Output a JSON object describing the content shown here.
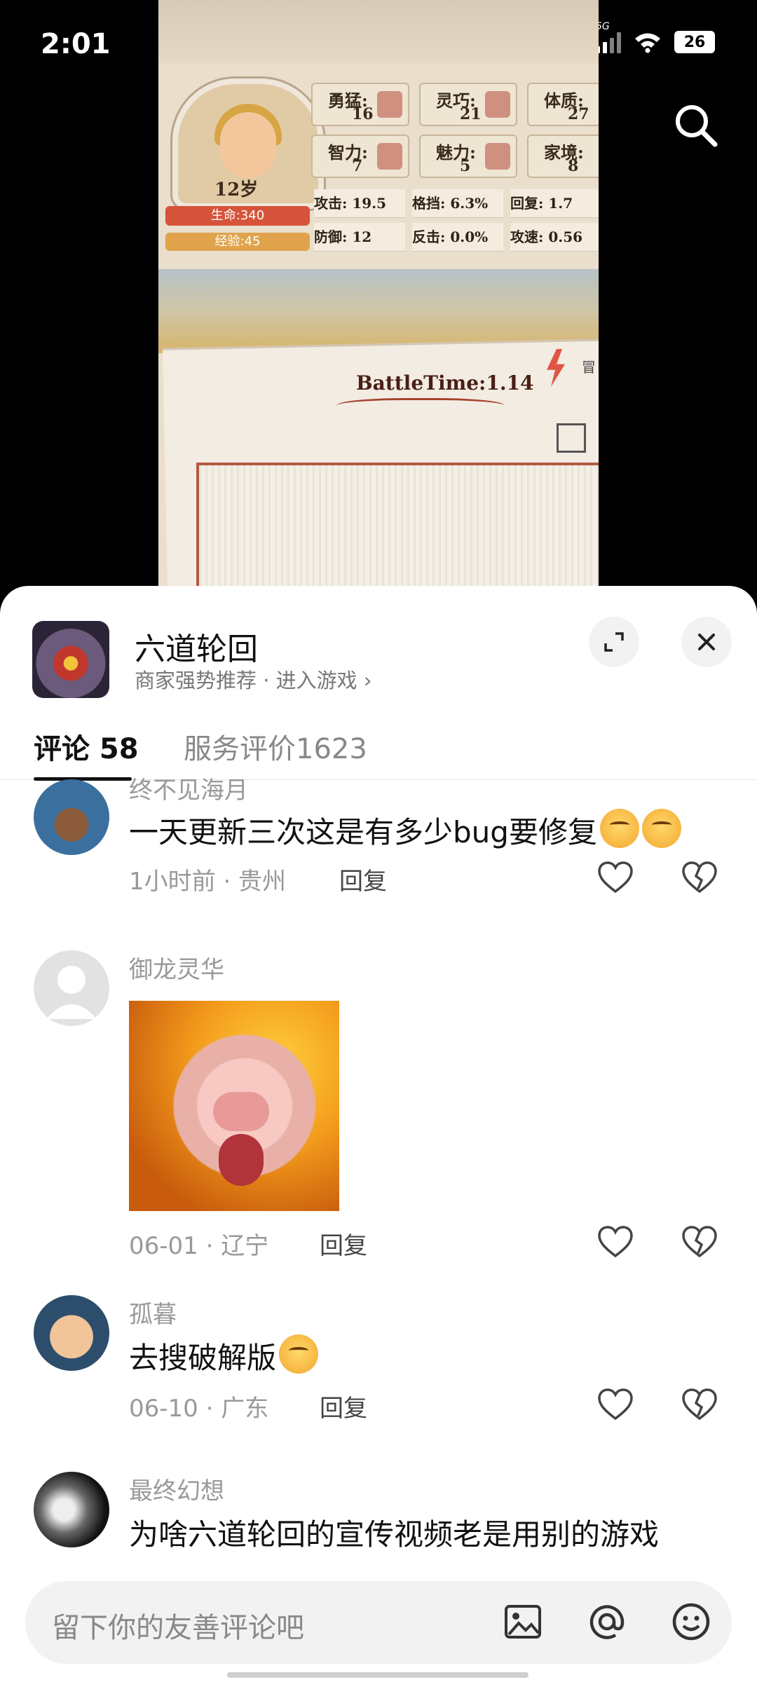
{
  "status_bar": {
    "time": "2:01",
    "signal_label_1": "5G",
    "signal_label_2": "5G",
    "battery": "26"
  },
  "game_video": {
    "age": "12岁",
    "hp": "生命:340",
    "xp": "经验:45",
    "stats": [
      {
        "name": "勇猛:",
        "value": "16"
      },
      {
        "name": "灵巧:",
        "value": "21"
      },
      {
        "name": "体质:",
        "value": "27"
      },
      {
        "name": "智力:",
        "value": "7"
      },
      {
        "name": "魅力:",
        "value": "5"
      },
      {
        "name": "家境:",
        "value": "8"
      }
    ],
    "attrs": [
      "攻击: 19.5",
      "格挡: 6.3%",
      "回复: 1.7",
      "防御: 12",
      "反击: 0.0%",
      "攻速: 0.56"
    ],
    "battle_time": "BattleTime:1.14",
    "corner_label": "冒"
  },
  "sheet": {
    "game_title": "六道轮回",
    "subtitle": "商家强势推荐 · 进入游戏 ›",
    "tabs": [
      {
        "label": "评论 58",
        "active": true
      },
      {
        "label": "服务评价1623",
        "active": false
      }
    ]
  },
  "comments": [
    {
      "name": "终不见海月",
      "text": "一天更新三次这是有多少bug要修复",
      "time_loc": "1小时前 · 贵州",
      "reply": "回复"
    },
    {
      "name": "御龙灵华",
      "text": "",
      "time_loc": "06-01 · 辽宁",
      "reply": "回复"
    },
    {
      "name": "孤暮",
      "text": "去搜破解版",
      "time_loc": "06-10 · 广东",
      "reply": "回复"
    },
    {
      "name": "最终幻想",
      "text": "为啥六道轮回的宣传视频老是用别的游戏",
      "time_loc": "",
      "reply": ""
    }
  ],
  "input": {
    "placeholder": "留下你的友善评论吧"
  },
  "colors": {
    "accent": "#111111",
    "muted": "#999999",
    "sheet_bg": "#ffffff"
  }
}
